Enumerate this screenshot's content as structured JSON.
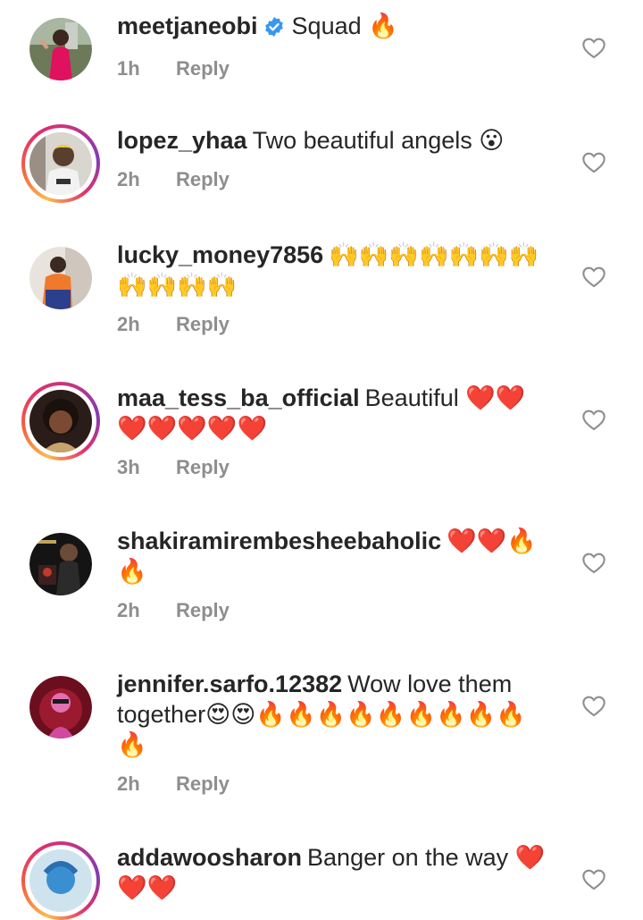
{
  "comments": [
    {
      "username": "meetjaneobi",
      "verified": true,
      "text": "Squad 🔥",
      "time": "1h",
      "reply": "Reply"
    },
    {
      "username": "lopez_yhaa",
      "verified": false,
      "text": "Two beautiful angels 😮",
      "time": "2h",
      "reply": "Reply"
    },
    {
      "username": "lucky_money7856",
      "verified": false,
      "text": "🙌🙌🙌🙌🙌🙌🙌🙌🙌🙌🙌",
      "time": "2h",
      "reply": "Reply"
    },
    {
      "username": "maa_tess_ba_official",
      "verified": false,
      "text": "Beautiful ❤️❤️❤️❤️❤️❤️❤️",
      "time": "3h",
      "reply": "Reply"
    },
    {
      "username": "shakiramirembesheebaholic",
      "verified": false,
      "text": "❤️❤️🔥🔥",
      "time": "2h",
      "reply": "Reply"
    },
    {
      "username": "jennifer.sarfo.12382",
      "verified": false,
      "text": "Wow love them together😍😍🔥🔥🔥🔥🔥🔥🔥🔥🔥🔥",
      "time": "2h",
      "reply": "Reply"
    },
    {
      "username": "addawoosharon",
      "verified": false,
      "text": "Banger on the way ❤️❤️❤️",
      "time": "",
      "reply": ""
    }
  ],
  "icons": {
    "like": "heart-outline-icon",
    "verified": "verified-badge-icon"
  },
  "colors": {
    "verified": "#3897f0",
    "meta": "#8e8e8e",
    "text": "#262626"
  }
}
